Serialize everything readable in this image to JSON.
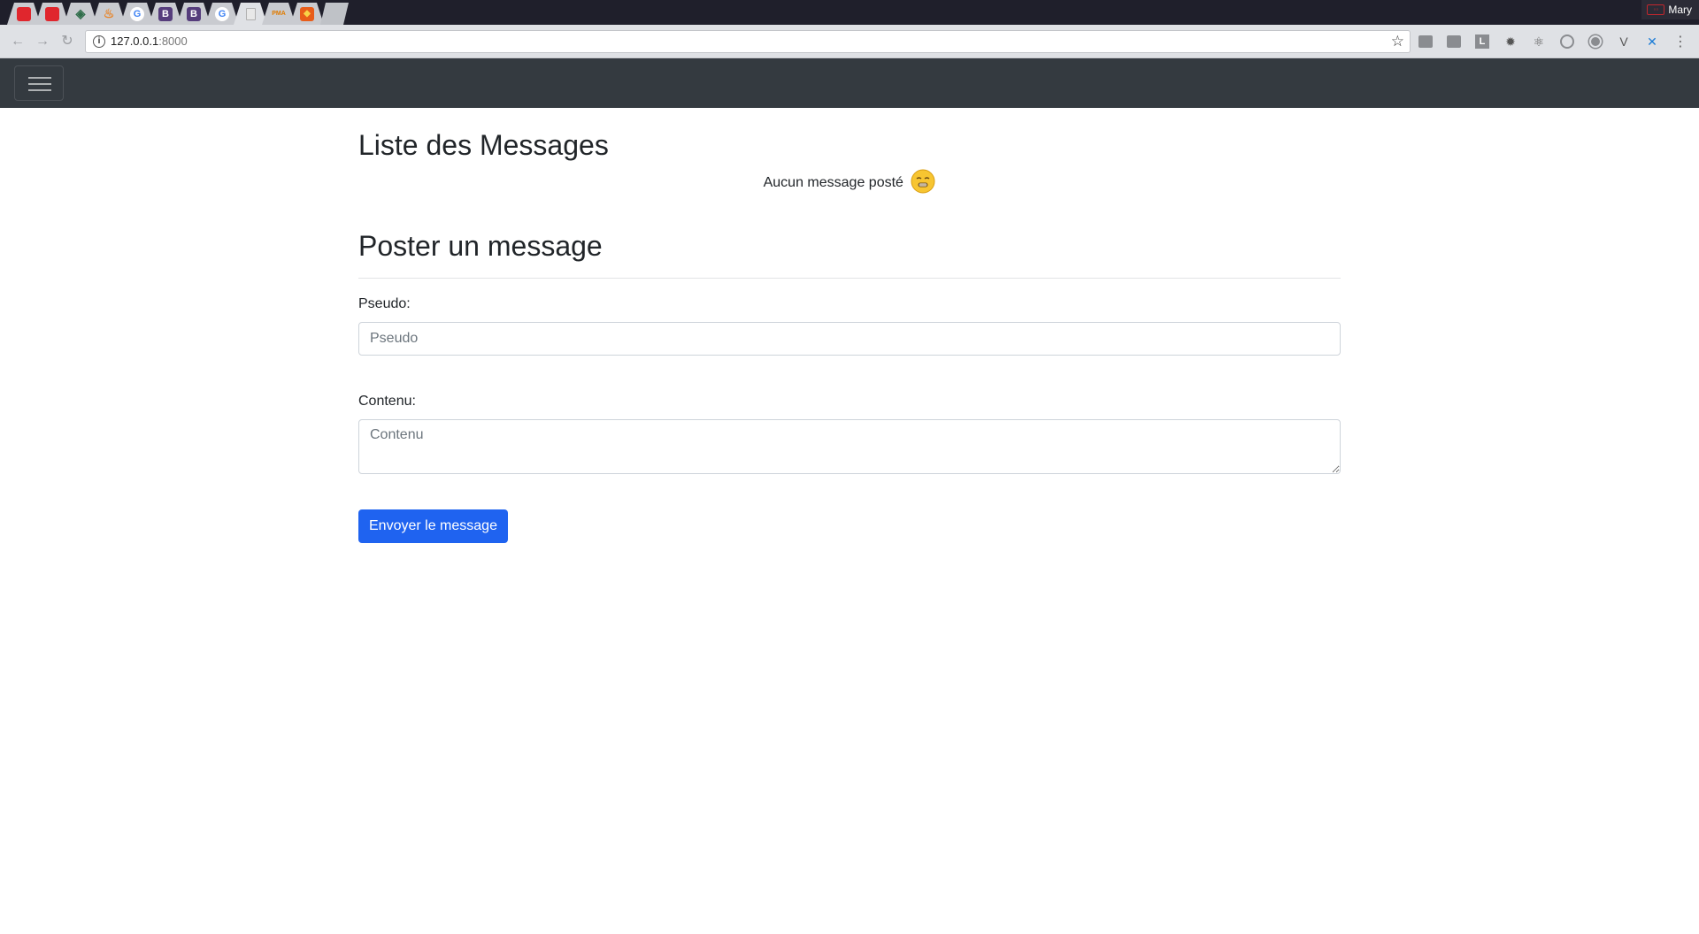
{
  "browser": {
    "tabs": [
      {
        "icon": "red-square-icon",
        "active": false
      },
      {
        "icon": "red-square-icon",
        "active": false
      },
      {
        "icon": "diamond-icon",
        "active": false
      },
      {
        "icon": "flame-icon",
        "active": false
      },
      {
        "icon": "google-icon",
        "glyph": "G",
        "active": false
      },
      {
        "icon": "bootstrap-icon",
        "glyph": "B",
        "active": false
      },
      {
        "icon": "bootstrap-icon",
        "glyph": "B",
        "active": false
      },
      {
        "icon": "google-icon",
        "glyph": "G",
        "active": false
      },
      {
        "icon": "document-icon",
        "active": true
      },
      {
        "icon": "phpmyadmin-icon",
        "glyph": "PMA",
        "active": false
      },
      {
        "icon": "shield-icon",
        "active": false
      }
    ],
    "profile_name": "Mary",
    "address": {
      "host": "127.0.0.1",
      "port": ":8000"
    },
    "extensions": [
      "extension-icon",
      "extension-icon",
      "letter-l-icon",
      "gear-icon",
      "react-icon",
      "target-icon",
      "circle-icon",
      "vue-icon",
      "cross-icon"
    ]
  },
  "colors": {
    "navbar_bg": "#343a40",
    "primary_button": "#1f63f0",
    "text": "#212529"
  },
  "page": {
    "list_title": "Liste des Messages",
    "empty_text": "Aucun message posté",
    "post_title": "Poster un message",
    "form": {
      "pseudo_label": "Pseudo:",
      "pseudo_placeholder": "Pseudo",
      "content_label": "Contenu:",
      "content_placeholder": "Contenu",
      "submit_label": "Envoyer le message"
    }
  }
}
